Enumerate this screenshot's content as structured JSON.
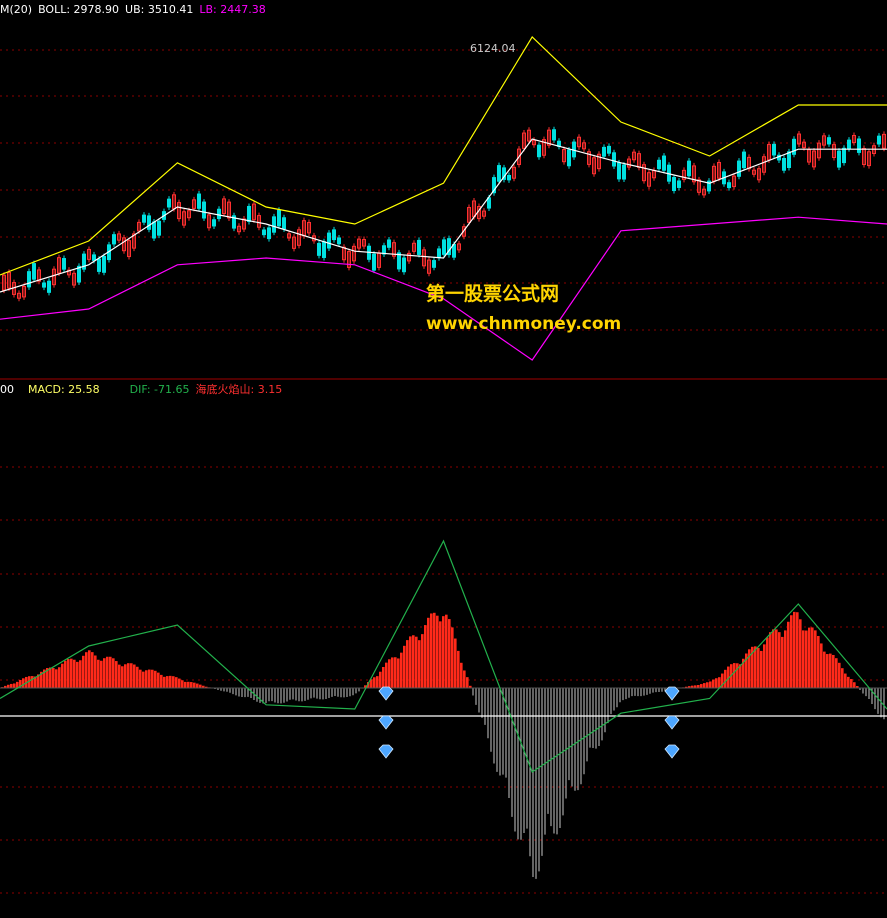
{
  "colors": {
    "background": "#000000",
    "grid": "#8b0000",
    "separator": "#a00000",
    "boll_mid": "#ffffff",
    "boll_ub": "#ffff00",
    "boll_lb": "#ff00ff",
    "candle_up": "#ff3030",
    "candle_down": "#00e0e0",
    "macd_pos": "#ff2a1a",
    "macd_neg": "#c8c8c8",
    "dif_line": "#22b14c",
    "zero_line": "#ffffff",
    "watermark": "#ffd400",
    "gem": "#4da6ff"
  },
  "top_header": {
    "lead": "M(20)",
    "boll": "BOLL: 2978.90",
    "ub": "UB: 3510.41",
    "lb": "LB: 2447.38"
  },
  "bottom_header": {
    "lead": "00",
    "macd": "MACD: 25.58",
    "dif": "DIF: -71.65",
    "custom": "海底火焰山: 3.15"
  },
  "peak_label": "6124.04",
  "watermark": {
    "line1": "第一股票公式网",
    "line2": "www.chnmoney.com"
  },
  "chart_data": [
    {
      "type": "line",
      "series_names": [
        "BOLL",
        "UB",
        "LB"
      ],
      "peak_annotation": "6124.04",
      "ylim": [
        0,
        100
      ],
      "grid": true,
      "x": [
        0,
        10,
        20,
        30,
        40,
        50,
        60,
        70,
        80,
        90,
        100
      ],
      "series": [
        {
          "name": "BOLL",
          "values": [
            20,
            28,
            45,
            40,
            32,
            30,
            65,
            58,
            52,
            62,
            62
          ]
        },
        {
          "name": "UB",
          "values": [
            25,
            35,
            58,
            45,
            40,
            52,
            95,
            70,
            60,
            75,
            75
          ]
        },
        {
          "name": "LB",
          "values": [
            12,
            15,
            28,
            30,
            28,
            18,
            0,
            38,
            40,
            42,
            40
          ]
        }
      ]
    },
    {
      "type": "bar",
      "series_names": [
        "MACD",
        "DIF"
      ],
      "ylim": [
        -100,
        100
      ],
      "grid": true,
      "x": [
        0,
        10,
        20,
        30,
        40,
        50,
        60,
        70,
        80,
        90,
        100
      ],
      "series": [
        {
          "name": "MACD",
          "values": [
            0,
            18,
            5,
            -8,
            -4,
            42,
            -95,
            -6,
            3,
            38,
            -18
          ]
        },
        {
          "name": "DIF",
          "values": [
            -5,
            20,
            30,
            -8,
            -10,
            70,
            -40,
            -12,
            -5,
            40,
            -10
          ]
        }
      ]
    }
  ]
}
